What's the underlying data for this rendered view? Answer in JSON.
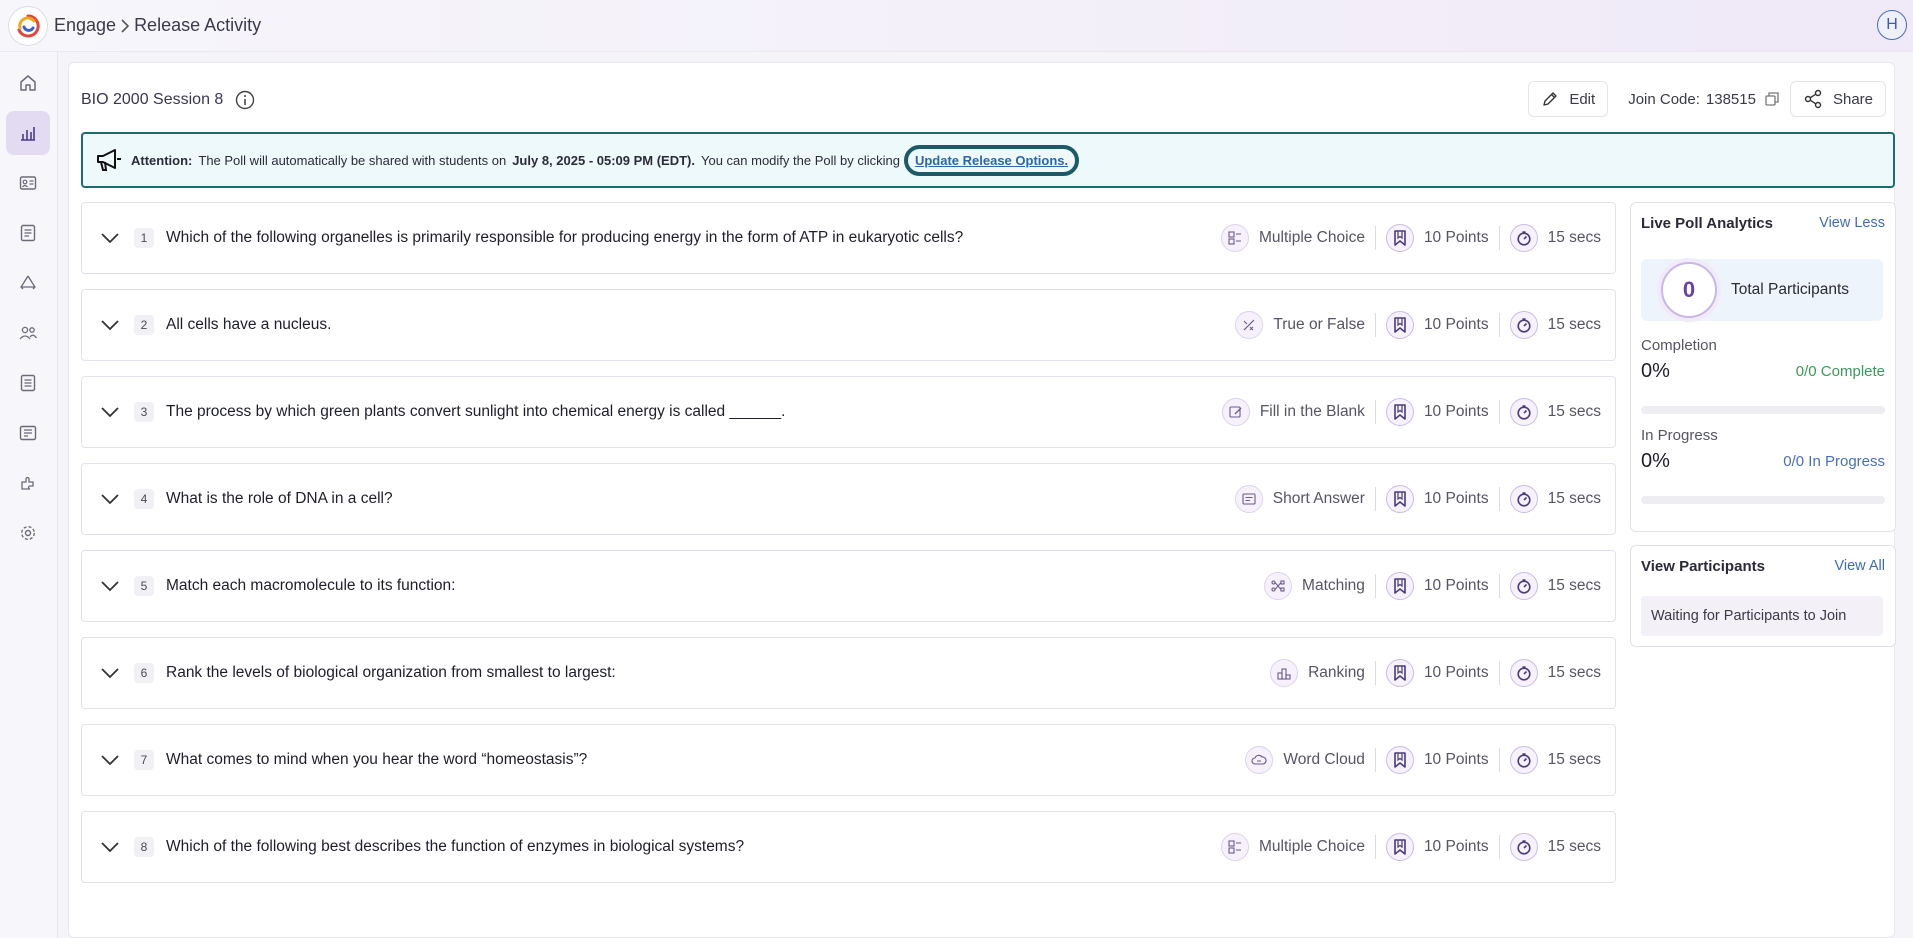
{
  "breadcrumb": {
    "app": "Engage",
    "page": "Release Activity"
  },
  "user": {
    "initial": "H"
  },
  "sidebar": {
    "items": [
      {
        "icon": "home-icon"
      },
      {
        "icon": "chart-icon",
        "active": true
      },
      {
        "icon": "id-card-icon"
      },
      {
        "icon": "document-icon"
      },
      {
        "icon": "recycle-icon"
      },
      {
        "icon": "users-icon"
      },
      {
        "icon": "list-icon"
      },
      {
        "icon": "gradebook-icon"
      },
      {
        "icon": "puzzle-icon"
      },
      {
        "icon": "gear-icon"
      }
    ]
  },
  "session": {
    "title": "BIO 2000 Session 8",
    "edit_label": "Edit",
    "join_code_label": "Join Code:",
    "join_code": "138515",
    "share_label": "Share"
  },
  "banner": {
    "attention": "Attention:",
    "text_before": "The Poll will automatically be shared with students on",
    "date": "July 8, 2025 - 05:09 PM (EDT).",
    "text_after": "You can modify the Poll by clicking",
    "link": "Update Release Options."
  },
  "questions": [
    {
      "num": "1",
      "text": "Which of the following organelles is primarily responsible for producing energy in the form of ATP in eukaryotic cells?",
      "type": "Multiple Choice",
      "type_icon": "multiple-choice-icon",
      "points": "10 Points",
      "time": "15 secs"
    },
    {
      "num": "2",
      "text": "All cells have a nucleus.",
      "type": "True or False",
      "type_icon": "true-false-icon",
      "points": "10 Points",
      "time": "15 secs"
    },
    {
      "num": "3",
      "text": "The process by which green plants convert sunlight into chemical energy is called ______.",
      "type": "Fill in the Blank",
      "type_icon": "fill-blank-icon",
      "points": "10 Points",
      "time": "15 secs"
    },
    {
      "num": "4",
      "text": "What is the role of DNA in a cell?",
      "type": "Short Answer",
      "type_icon": "short-answer-icon",
      "points": "10 Points",
      "time": "15 secs"
    },
    {
      "num": "5",
      "text": "Match each macromolecule to its function:",
      "type": "Matching",
      "type_icon": "matching-icon",
      "points": "10 Points",
      "time": "15 secs"
    },
    {
      "num": "6",
      "text": "Rank the levels of biological organization from smallest to largest:",
      "type": "Ranking",
      "type_icon": "ranking-icon",
      "points": "10 Points",
      "time": "15 secs"
    },
    {
      "num": "7",
      "text": "What comes to mind when you hear the word “homeostasis”?",
      "type": "Word Cloud",
      "type_icon": "word-cloud-icon",
      "points": "10 Points",
      "time": "15 secs"
    },
    {
      "num": "8",
      "text": "Which of the following best describes the function of enzymes in biological systems?",
      "type": "Multiple Choice",
      "type_icon": "multiple-choice-icon",
      "points": "10 Points",
      "time": "15 secs"
    }
  ],
  "analytics": {
    "title": "Live Poll Analytics",
    "view_less": "View Less",
    "total_count": "0",
    "total_label": "Total Participants",
    "completion_label": "Completion",
    "completion_pct": "0%",
    "completion_status": "0/0 Complete",
    "completion_fraction": 0,
    "progress_label": "In Progress",
    "progress_pct": "0%",
    "progress_status": "0/0 In Progress",
    "progress_fraction": 0
  },
  "participants": {
    "title": "View Participants",
    "view_all": "View All",
    "waiting": "Waiting for Participants to Join"
  },
  "colors": {
    "accent": "#6b3fa8",
    "banner_border": "#1e6b72",
    "link": "#3d6cb5",
    "complete": "#3a9a5a"
  }
}
